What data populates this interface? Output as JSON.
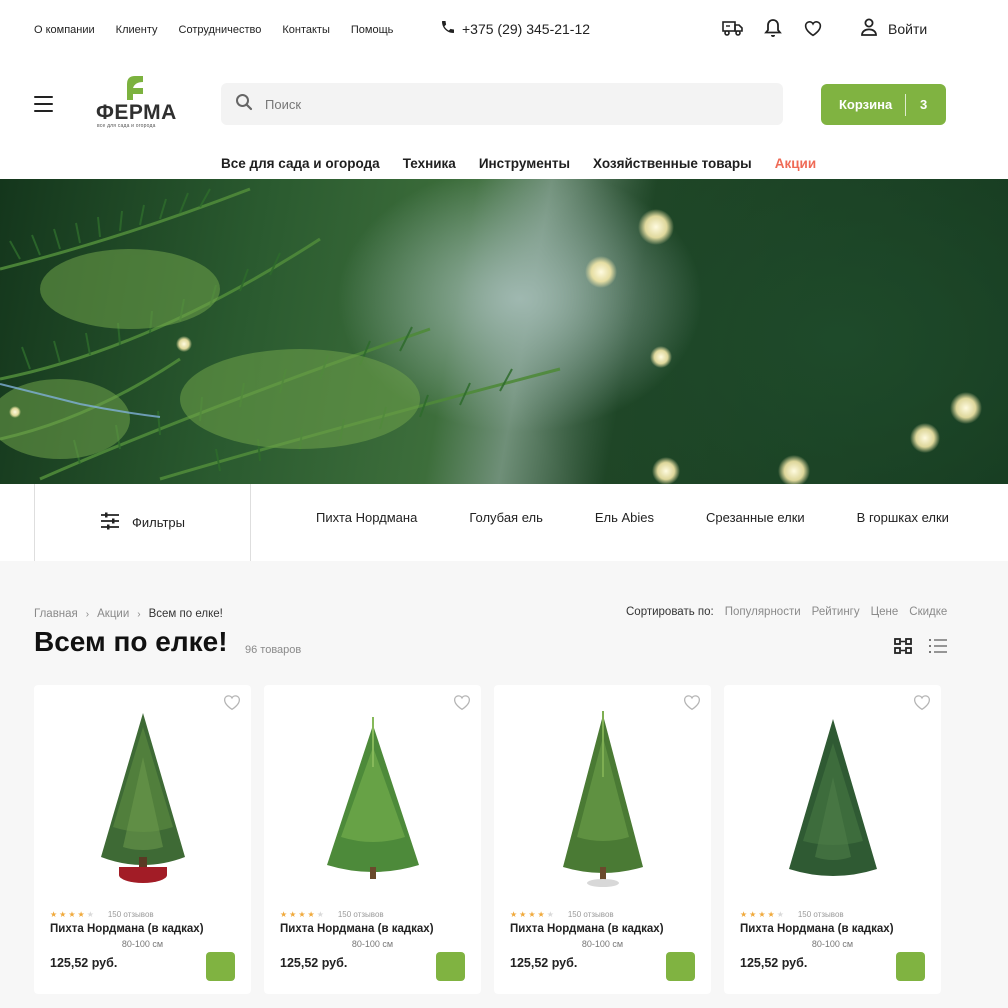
{
  "topbar": {
    "links": [
      "О компании",
      "Клиенту",
      "Сотрудничество",
      "Контакты",
      "Помощь"
    ],
    "phone": "+375 (29) 345-21-12",
    "login_label": "Войти"
  },
  "header": {
    "logo_name": "ФЕРМА",
    "logo_tagline": "все для сада и огорода",
    "search_placeholder": "Поиск",
    "cart_label": "Корзина",
    "cart_count": "3"
  },
  "nav": {
    "items": [
      "Все для сада и огорода",
      "Техника",
      "Инструменты",
      "Хозяйственные товары",
      "Акции"
    ]
  },
  "filters": {
    "label": "Фильтры",
    "categories": [
      "Пихта Нордмана",
      "Голубая ель",
      "Ель Abies",
      "Срезанные елки",
      "В горшках елки"
    ]
  },
  "catalog": {
    "breadcrumbs": [
      "Главная",
      "Акции",
      "Всем по елке!"
    ],
    "sort_label": "Сортировать по:",
    "sort_options": [
      "Популярности",
      "Рейтингу",
      "Цене",
      "Скидке"
    ],
    "title": "Всем по елке!",
    "count": "96 товаров",
    "products": [
      {
        "name": "Пихта Нордмана (в кадках)",
        "size": "80-100 см",
        "price": "125,52 руб.",
        "reviews": "150 отзывов",
        "rating": 4
      },
      {
        "name": "Пихта Нордмана (в кадках)",
        "size": "80-100 см",
        "price": "125,52 руб.",
        "reviews": "150 отзывов",
        "rating": 4
      },
      {
        "name": "Пихта Нордмана (в кадках)",
        "size": "80-100 см",
        "price": "125,52 руб.",
        "reviews": "150 отзывов",
        "rating": 4
      },
      {
        "name": "Пихта Нордмана (в кадках)",
        "size": "80-100 см",
        "price": "125,52 руб.",
        "reviews": "150 отзывов",
        "rating": 4
      }
    ]
  },
  "colors": {
    "accent": "#80b341",
    "sale": "#ef6a55",
    "star": "#f0a93b",
    "star_empty": "#d9d9d9"
  }
}
